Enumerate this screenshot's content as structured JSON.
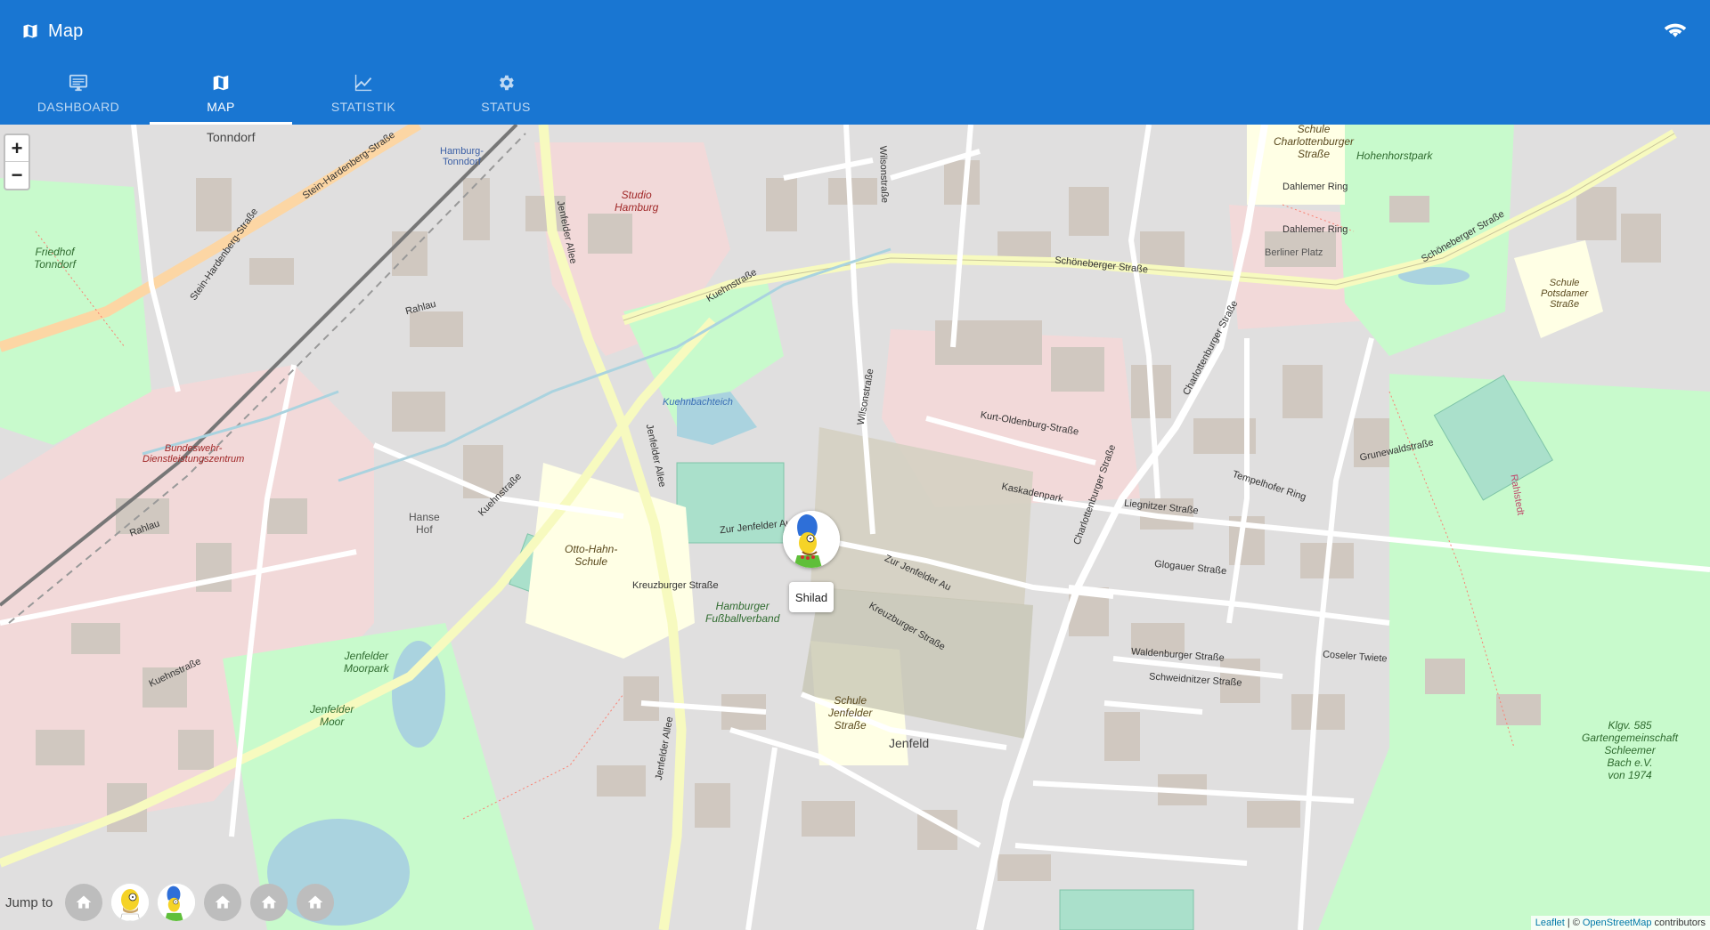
{
  "app": {
    "title": "Map"
  },
  "tabs": [
    {
      "label": "DASHBOARD",
      "icon": "monitor-icon",
      "active": false
    },
    {
      "label": "MAP",
      "icon": "map-icon",
      "active": true
    },
    {
      "label": "STATISTIK",
      "icon": "chart-line-icon",
      "active": false
    },
    {
      "label": "STATUS",
      "icon": "gear-icon",
      "active": false
    }
  ],
  "map": {
    "zoom_in": "+",
    "zoom_out": "−",
    "places": {
      "tonndorf": "Tonndorf",
      "jenfeld": "Jenfeld",
      "hamburg_tonndorf": "Hamburg-\nTonndorf",
      "hanse_hof": "Hanse\nHof",
      "berliner_platz": "Berliner Platz",
      "rahlstedt": "Rahlstedt",
      "hohenhorstpark": "Hohenhorstpark",
      "friedhof": "Friedhof\nTonndorf",
      "studio": "Studio\nHamburg",
      "bundeswehr": "Bundeswehr-\nDienstleistungszentrum",
      "fussballverband": "Hamburger\nFußballverband",
      "otto_hahn": "Otto-Hahn-\nSchule",
      "jenfelder_moorpark": "Jenfelder\nMoorpark",
      "jenfelder_moor": "Jenfelder\nMoor",
      "schule_charlottenburger": "Schule\nCharlottenburger\nStraße",
      "schule_potsdamer": "Schule\nPotsdamer\nStraße",
      "schule_jenfelder": "Schule\nJenfelder\nStraße",
      "kuehnbachteich": "Kuehnbachteich",
      "kleingarten": "Klgv. 585\nGartengemeinschaft\nSchleemer\nBach e.V.\nvon 1974"
    },
    "streets": {
      "schoenberger": "Schöneberger Straße",
      "kuehnstrasse": "Kuehnstraße",
      "jenfelder_allee": "Jenfelder Allee",
      "kurt_oldenburg": "Kurt-Oldenburg-Straße",
      "charlottenburger": "Charlottenburger Straße",
      "kaskadenpark": "Kaskadenpark",
      "liegnitzer": "Liegnitzer Straße",
      "glogauer": "Glogauer Straße",
      "waldenburger": "Waldenburger Straße",
      "kreuzburger": "Kreuzburger Straße",
      "zur_jenfelder_au": "Zur Jenfelder Au",
      "stein_hardenberg": "Stein-Hardenberg-Straße",
      "rahlau": "Rahlau",
      "grunewald": "Grunewaldstraße",
      "dahlemer_ring": "Dahlemer Ring",
      "wilsonstrasse": "Wilsonstraße",
      "tempelhofer_ring": "Tempelhofer Ring",
      "schweidnitzer": "Schweidnitzer Straße",
      "coseler": "Coseler Twiete"
    },
    "marker": {
      "name": "Shilad"
    }
  },
  "jump": {
    "label": "Jump to",
    "buttons": [
      {
        "type": "home",
        "icon": "home-icon"
      },
      {
        "type": "avatar",
        "icon": "homer-avatar-icon"
      },
      {
        "type": "avatar",
        "icon": "marge-avatar-icon"
      },
      {
        "type": "home",
        "icon": "home-icon"
      },
      {
        "type": "home",
        "icon": "home-icon"
      },
      {
        "type": "home",
        "icon": "home-icon"
      }
    ]
  },
  "attribution": {
    "leaflet": "Leaflet",
    "separator": "| ©",
    "osm": "OpenStreetMap",
    "suffix": "contributors"
  },
  "colors": {
    "appbar": "#1976d2",
    "map_bg": "#f2efe9",
    "residential": "#e0dfdf",
    "retail": "#f2d9d9",
    "park": "#c8facc",
    "school": "#ffffe5",
    "primary_road": "#fcd6a4",
    "secondary_road": "#f7fabf",
    "water": "#aad3df"
  }
}
